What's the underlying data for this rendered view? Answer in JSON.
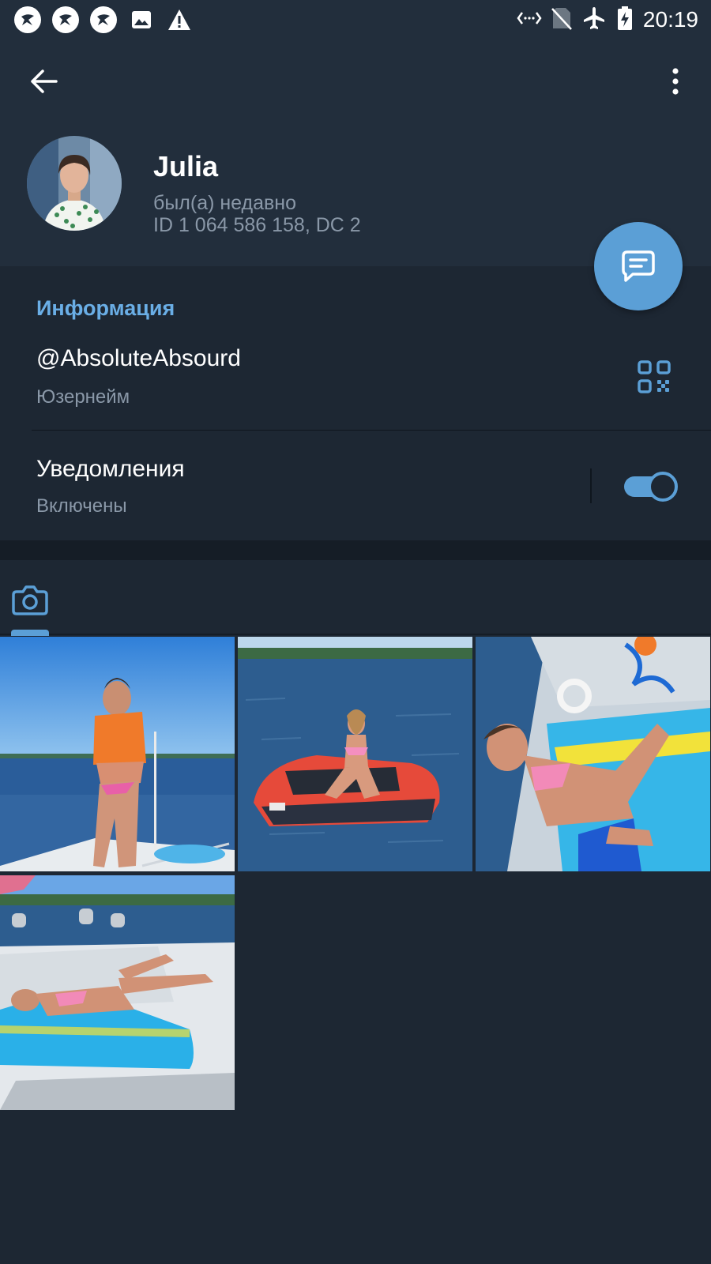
{
  "status_bar": {
    "time": "20:19",
    "icons_left": [
      "app-notification-icon",
      "app-notification-icon",
      "app-notification-icon",
      "image-icon",
      "warning-icon"
    ],
    "icons_right": [
      "data-arrows-icon",
      "no-sim-icon",
      "airplane-icon",
      "battery-charging-icon"
    ]
  },
  "profile": {
    "name": "Julia",
    "status": "был(а) недавно",
    "id_line": "ID 1 064 586 158, DC 2"
  },
  "info": {
    "section_title": "Информация",
    "username": "@AbsoluteAbsourd",
    "username_label": "Юзернейм",
    "notifications_title": "Уведомления",
    "notifications_value": "Включены",
    "notifications_enabled": true
  },
  "media": {
    "active_tab_icon": "camera-icon",
    "photos": [
      {
        "name": "photo-1"
      },
      {
        "name": "photo-2"
      },
      {
        "name": "photo-3"
      },
      {
        "name": "photo-4"
      }
    ]
  },
  "colors": {
    "accent": "#5b9fd6",
    "header_bg": "#222e3c",
    "page_bg": "#1d2733",
    "secondary_text": "#8a98a8",
    "section_title": "#6aaee6"
  }
}
